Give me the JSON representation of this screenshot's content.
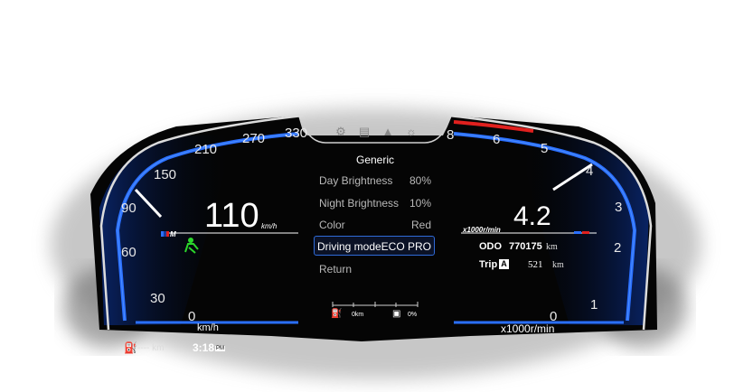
{
  "speedometer": {
    "ticks": [
      "0",
      "30",
      "60",
      "90",
      "150",
      "210",
      "270",
      "330"
    ],
    "speed_value": "110",
    "speed_unit": "km/h",
    "scale_unit": "km/h"
  },
  "tachometer": {
    "ticks": [
      "0",
      "1",
      "2",
      "3",
      "4",
      "5",
      "6",
      "8"
    ],
    "rpm_value": "4.2",
    "rpm_unit": "x1000r/min",
    "scale_unit": "x1000r/min"
  },
  "menu": {
    "title": "Generic",
    "items": [
      {
        "label": "Day Brightness",
        "value": "80%"
      },
      {
        "label": "Night Brightness",
        "value": "10%"
      },
      {
        "label": "Color",
        "value": "Red"
      },
      {
        "label": "Driving mode",
        "value": "ECO PRO",
        "selected": true
      },
      {
        "label": "Return",
        "value": ""
      }
    ],
    "icons": [
      "wrench-icon",
      "document-icon",
      "car-icon",
      "gear-icon"
    ]
  },
  "fuel": {
    "range_label": "0km",
    "percent_label": "0%"
  },
  "odometer": {
    "label": "ODO",
    "value": "770175",
    "unit": "km"
  },
  "trip": {
    "label": "Trip",
    "badge": "A",
    "value": "521",
    "unit": "km"
  },
  "status_bar": {
    "range": "---- km",
    "time": "3:18",
    "time_suffix": "PM"
  },
  "colors": {
    "accent_blue": "#2a6fff",
    "needle": "#ffffff",
    "eco_green": "#2bd62b",
    "redline": "#e0201e"
  }
}
